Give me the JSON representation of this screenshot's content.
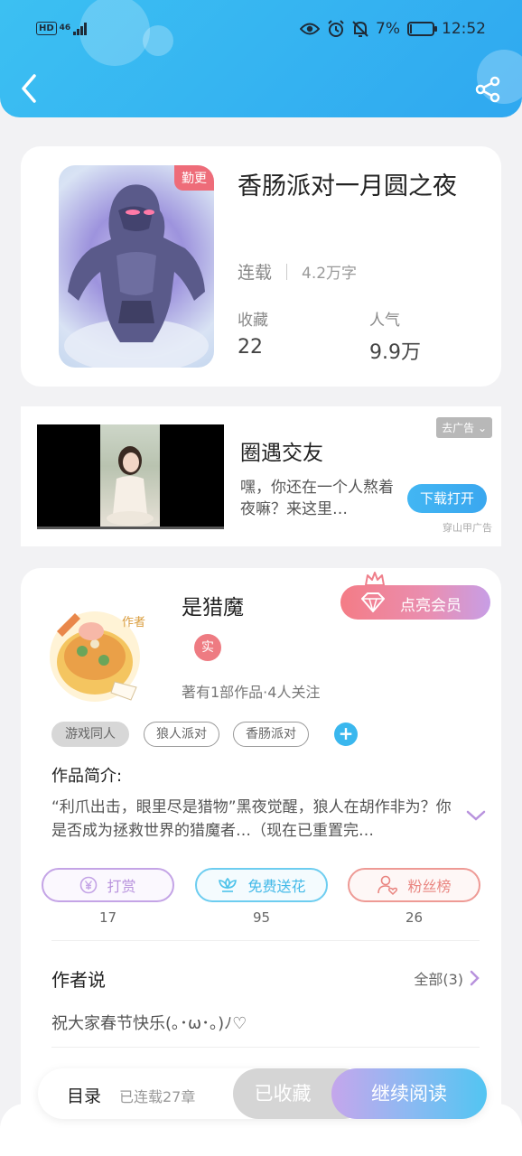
{
  "status_bar": {
    "hd_label": "HD",
    "network_label": "46",
    "battery_text": "7%",
    "time": "12:52",
    "icons": [
      "eye-icon",
      "alarm-icon",
      "mute-bell-icon",
      "battery-icon"
    ]
  },
  "header": {
    "back_icon": "chevron-left-icon",
    "share_icon": "share-icon",
    "background": "#36b6f2"
  },
  "book": {
    "update_badge": "勤更",
    "title": "香肠派对一月圆之夜",
    "status": "连载",
    "word_count": "4.2万字",
    "collect_label": "收藏",
    "collect_value": "22",
    "popularity_label": "人气",
    "popularity_value": "9.9万"
  },
  "ad": {
    "remove_label": "去广告",
    "title": "圈遇交友",
    "desc": "嘿，你还在一个人熬着夜嘛？来这里…",
    "button": "下载打开",
    "source": "穿山甲广告"
  },
  "author": {
    "name": "是猎魔",
    "real_badge": "实",
    "info": "著有1部作品·4人关注",
    "vip_button": "点亮会员",
    "avatar_label": "作者",
    "tags": [
      "游戏同人",
      "狼人派对",
      "香肠派对"
    ],
    "tag_add": "+",
    "intro_title": "作品简介:",
    "intro_text": "“利爪出击，眼里尽是猎物”黑夜觉醒，狼人在胡作非为？你是否成为拯救世界的猎魔者…（现在已重置完…",
    "actions": [
      {
        "label": "打赏",
        "count": "17",
        "color": "#b892dd"
      },
      {
        "label": "免费送花",
        "count": "95",
        "color": "#4ec3ea"
      },
      {
        "label": "粉丝榜",
        "count": "26",
        "color": "#e98580"
      }
    ],
    "says_title": "作者说",
    "says_all": "全部(3)",
    "says_text": "祝大家春节快乐(｡･ω･｡)ﾉ♡"
  },
  "bottom": {
    "toc": "目录",
    "chapters": "已连载27章",
    "favorited": "已收藏",
    "continue": "继续阅读"
  }
}
